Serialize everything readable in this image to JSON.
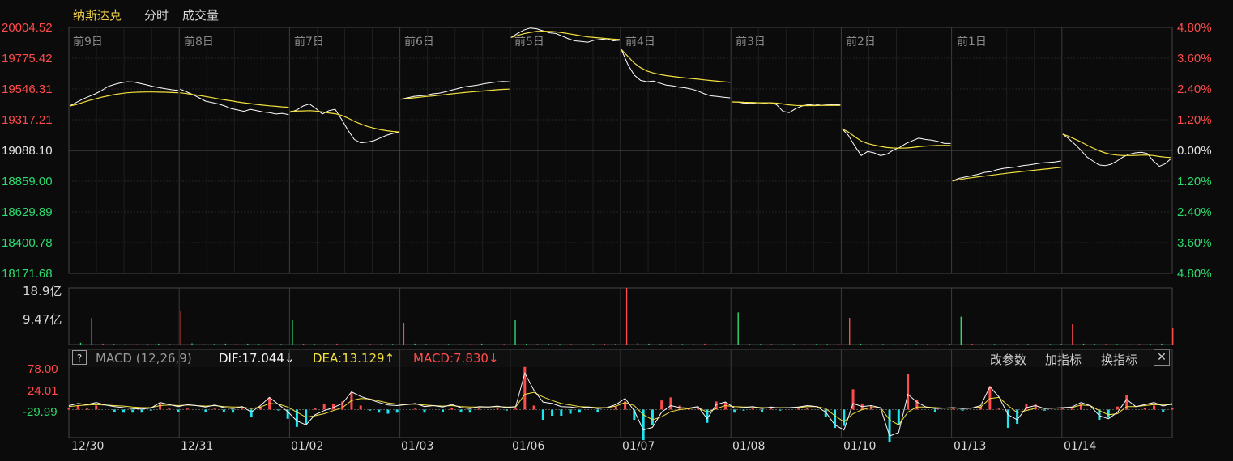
{
  "tabs": [
    {
      "label": "纳斯达克",
      "active": true
    },
    {
      "label": "分时",
      "active": false
    },
    {
      "label": "成交量",
      "active": false
    }
  ],
  "y_axis_left": [
    "20004.52",
    "19775.42",
    "19546.31",
    "19317.21",
    "19088.10",
    "18859.00",
    "18629.89",
    "18400.78",
    "18171.68"
  ],
  "y_axis_right": [
    "4.80%",
    "3.60%",
    "2.40%",
    "1.20%",
    "0.00%",
    "1.20%",
    "2.40%",
    "3.60%",
    "4.80%"
  ],
  "day_labels": [
    "前9日",
    "前8日",
    "前7日",
    "前6日",
    "前5日",
    "前4日",
    "前3日",
    "前2日",
    "前1日"
  ],
  "x_labels": [
    "12/30",
    "12/31",
    "01/02",
    "01/03",
    "01/06",
    "01/07",
    "01/08",
    "01/10",
    "01/13",
    "01/14"
  ],
  "volume_axis": [
    "18.9亿",
    "9.47亿"
  ],
  "macd": {
    "help": "?",
    "name": "MACD (12,26,9)",
    "dif": "DIF:17.044↓",
    "dea": "DEA:13.129↑",
    "macd": "MACD:7.830↓",
    "axis": [
      "78.00",
      "24.01",
      "-29.99"
    ],
    "buttons": [
      "改参数",
      "加指标",
      "换指标"
    ],
    "close": "✕"
  },
  "colors": {
    "up": "#ff4b4b",
    "down": "#2ddb6e",
    "price_line": "#ffffff",
    "avg_line": "#f3e03f",
    "macd_neg": "#1ee6f0",
    "grid": "#3a3a3a"
  },
  "chart_data": {
    "type": "line",
    "title": "",
    "prev_close": 19088.1,
    "ylim": [
      18171.68,
      20004.52
    ],
    "categories": [
      "前9日",
      "前8日",
      "前7日",
      "前6日",
      "前5日",
      "前4日",
      "前3日",
      "前2日",
      "前1日",
      "01/14"
    ],
    "series": [
      {
        "values": [
          [
            19420,
            19445,
            19470,
            19490,
            19510,
            19535,
            19565,
            19580,
            19592,
            19600,
            19598,
            19588,
            19577,
            19565,
            19556,
            19548,
            19540,
            19535
          ],
          [
            19545,
            19525,
            19505,
            19480,
            19455,
            19445,
            19435,
            19420,
            19400,
            19390,
            19380,
            19395,
            19385,
            19375,
            19370,
            19360,
            19365,
            19355
          ],
          [
            19372,
            19390,
            19420,
            19435,
            19400,
            19360,
            19385,
            19395,
            19320,
            19240,
            19170,
            19145,
            19150,
            19160,
            19180,
            19200,
            19215,
            19225
          ],
          [
            19470,
            19480,
            19490,
            19495,
            19500,
            19510,
            19515,
            19525,
            19538,
            19550,
            19562,
            19568,
            19575,
            19585,
            19592,
            19598,
            19602,
            19600
          ],
          [
            19930,
            19960,
            19985,
            20000,
            19995,
            19980,
            19965,
            19960,
            19940,
            19920,
            19905,
            19900,
            19895,
            19910,
            19915,
            19920,
            19905,
            19910
          ],
          [
            19840,
            19730,
            19650,
            19610,
            19600,
            19605,
            19590,
            19575,
            19570,
            19560,
            19555,
            19545,
            19530,
            19510,
            19495,
            19490,
            19485,
            19480
          ],
          [
            19450,
            19448,
            19440,
            19442,
            19435,
            19438,
            19445,
            19430,
            19380,
            19370,
            19400,
            19420,
            19430,
            19425,
            19435,
            19430,
            19428,
            19430
          ],
          [
            19250,
            19200,
            19120,
            19050,
            19080,
            19070,
            19050,
            19060,
            19090,
            19110,
            19140,
            19160,
            19180,
            19170,
            19165,
            19155,
            19140,
            19140
          ],
          [
            18860,
            18880,
            18890,
            18900,
            18910,
            18925,
            18930,
            18945,
            18955,
            18960,
            18965,
            18975,
            18980,
            18988,
            18995,
            18998,
            19002,
            19010
          ],
          [
            19210,
            19175,
            19135,
            19090,
            19040,
            19010,
            18980,
            18975,
            18985,
            19010,
            19040,
            19060,
            19070,
            19075,
            19065,
            19010,
            18970,
            18990,
            19030
          ]
        ]
      },
      {
        "values": [
          [
            19420,
            19430,
            19445,
            19460,
            19472,
            19485,
            19495,
            19505,
            19512,
            19518,
            19521,
            19523,
            19524,
            19524,
            19523,
            19522,
            19520,
            19518
          ],
          [
            19518,
            19512,
            19505,
            19498,
            19490,
            19482,
            19473,
            19465,
            19458,
            19450,
            19443,
            19437,
            19431,
            19426,
            19421,
            19417,
            19413,
            19410
          ],
          [
            19380,
            19382,
            19383,
            19385,
            19382,
            19375,
            19368,
            19362,
            19350,
            19330,
            19305,
            19285,
            19268,
            19255,
            19244,
            19236,
            19230,
            19226
          ],
          [
            19470,
            19475,
            19480,
            19485,
            19490,
            19494,
            19499,
            19504,
            19510,
            19515,
            19520,
            19524,
            19528,
            19532,
            19536,
            19540,
            19543,
            19545
          ],
          [
            19930,
            19945,
            19958,
            19968,
            19975,
            19977,
            19975,
            19972,
            19966,
            19958,
            19950,
            19942,
            19934,
            19930,
            19926,
            19922,
            19918,
            19915
          ],
          [
            19840,
            19790,
            19740,
            19705,
            19680,
            19665,
            19655,
            19646,
            19640,
            19634,
            19629,
            19624,
            19619,
            19614,
            19609,
            19604,
            19600,
            19596
          ],
          [
            19450,
            19449,
            19447,
            19446,
            19444,
            19443,
            19443,
            19441,
            19435,
            19428,
            19424,
            19423,
            19423,
            19423,
            19424,
            19424,
            19424,
            19424
          ],
          [
            19250,
            19225,
            19190,
            19158,
            19140,
            19128,
            19118,
            19110,
            19106,
            19105,
            19106,
            19110,
            19116,
            19120,
            19123,
            19125,
            19125,
            19125
          ],
          [
            18860,
            18870,
            18878,
            18885,
            18891,
            18897,
            18903,
            18909,
            18915,
            18921,
            18926,
            18932,
            18937,
            18942,
            18947,
            18952,
            18957,
            18962
          ],
          [
            19210,
            19193,
            19173,
            19152,
            19128,
            19106,
            19086,
            19070,
            19059,
            19053,
            19050,
            19050,
            19051,
            19053,
            19054,
            19050,
            19043,
            19038,
            19035
          ]
        ]
      }
    ],
    "volume": {
      "ylim": [
        0,
        18.9
      ],
      "unit": "亿",
      "values": [
        0,
        0.6,
        8.8,
        0.3,
        0.2,
        0.1,
        0.1,
        0.2,
        0.3,
        0.2,
        11.2,
        0.4,
        0.2,
        0.2,
        0.3,
        0.2,
        0.3,
        0.2,
        0.1,
        0.2,
        8.1,
        0.3,
        0.2,
        0.2,
        0.3,
        0.2,
        0.1,
        0.2,
        0.2,
        0.2,
        7.3,
        0.3,
        0.2,
        0.2,
        0.2,
        0.1,
        0.2,
        0.3,
        0.1,
        0.2,
        8.1,
        0.3,
        0.2,
        0.2,
        0.2,
        0.2,
        0.1,
        0.2,
        0.3,
        0.2,
        18.9,
        0.5,
        0.3,
        0.2,
        0.2,
        0.2,
        0.1,
        0.3,
        0.1,
        0.2,
        10.7,
        0.3,
        0.2,
        0.2,
        0.2,
        0.2,
        0.1,
        0.2,
        0.2,
        0.2,
        8.9,
        0.3,
        0.2,
        0.2,
        0.1,
        0.2,
        0.2,
        0.2,
        0.1,
        0.2,
        9.3,
        0.3,
        0.2,
        0.2,
        0.2,
        0.1,
        0.2,
        0.1,
        0.2,
        0.2,
        6.8,
        0.3,
        0.2,
        0.2,
        0.2,
        0.1,
        0.2,
        0.2,
        0.3,
        5.6
      ]
    },
    "macd_series": {
      "ylim": [
        -55,
        82
      ],
      "dif": [
        8,
        12,
        10,
        14,
        9,
        6,
        4,
        2,
        1,
        3,
        14,
        10,
        6,
        10,
        8,
        5,
        9,
        4,
        2,
        6,
        -5,
        8,
        24,
        10,
        -4,
        -22,
        -30,
        -10,
        -2,
        4,
        12,
        35,
        26,
        20,
        14,
        9,
        8,
        10,
        12,
        6,
        8,
        5,
        10,
        4,
        2,
        6,
        5,
        7,
        4,
        6,
        72,
        38,
        15,
        12,
        6,
        5,
        3,
        5,
        2,
        4,
        10,
        22,
        -2,
        -40,
        -35,
        -5,
        8,
        4,
        3,
        6,
        -18,
        10,
        15,
        3,
        4,
        6,
        2,
        5,
        3,
        4,
        5,
        8,
        6,
        -5,
        -30,
        -40,
        12,
        6,
        8,
        4,
        -52,
        -45,
        30,
        15,
        5,
        2,
        3,
        4,
        2,
        3,
        8,
        45,
        25,
        -10,
        -20,
        4,
        8,
        2,
        3,
        4,
        5,
        14,
        8,
        -12,
        -18,
        -5,
        20,
        6,
        10,
        14,
        7,
        12
      ],
      "dea": [
        6,
        8,
        9,
        10,
        9,
        8,
        7,
        5,
        4,
        4,
        8,
        9,
        8,
        9,
        8,
        7,
        8,
        6,
        5,
        5,
        2,
        5,
        12,
        11,
        5,
        -5,
        -15,
        -12,
        -8,
        -2,
        4,
        18,
        22,
        21,
        17,
        13,
        11,
        10,
        11,
        9,
        8,
        7,
        8,
        6,
        5,
        5,
        5,
        6,
        5,
        5,
        30,
        34,
        25,
        18,
        12,
        9,
        6,
        5,
        4,
        4,
        7,
        14,
        8,
        -10,
        -20,
        -14,
        -4,
        0,
        2,
        4,
        -5,
        2,
        8,
        6,
        5,
        5,
        4,
        4,
        4,
        4,
        4,
        6,
        6,
        2,
        -12,
        -24,
        -8,
        0,
        4,
        4,
        -20,
        -30,
        -5,
        5,
        5,
        4,
        3,
        3,
        3,
        3,
        5,
        22,
        24,
        8,
        -6,
        -2,
        3,
        3,
        3,
        3,
        4,
        9,
        8,
        -2,
        -10,
        -8,
        6,
        6,
        8,
        10,
        9,
        10
      ]
    }
  }
}
